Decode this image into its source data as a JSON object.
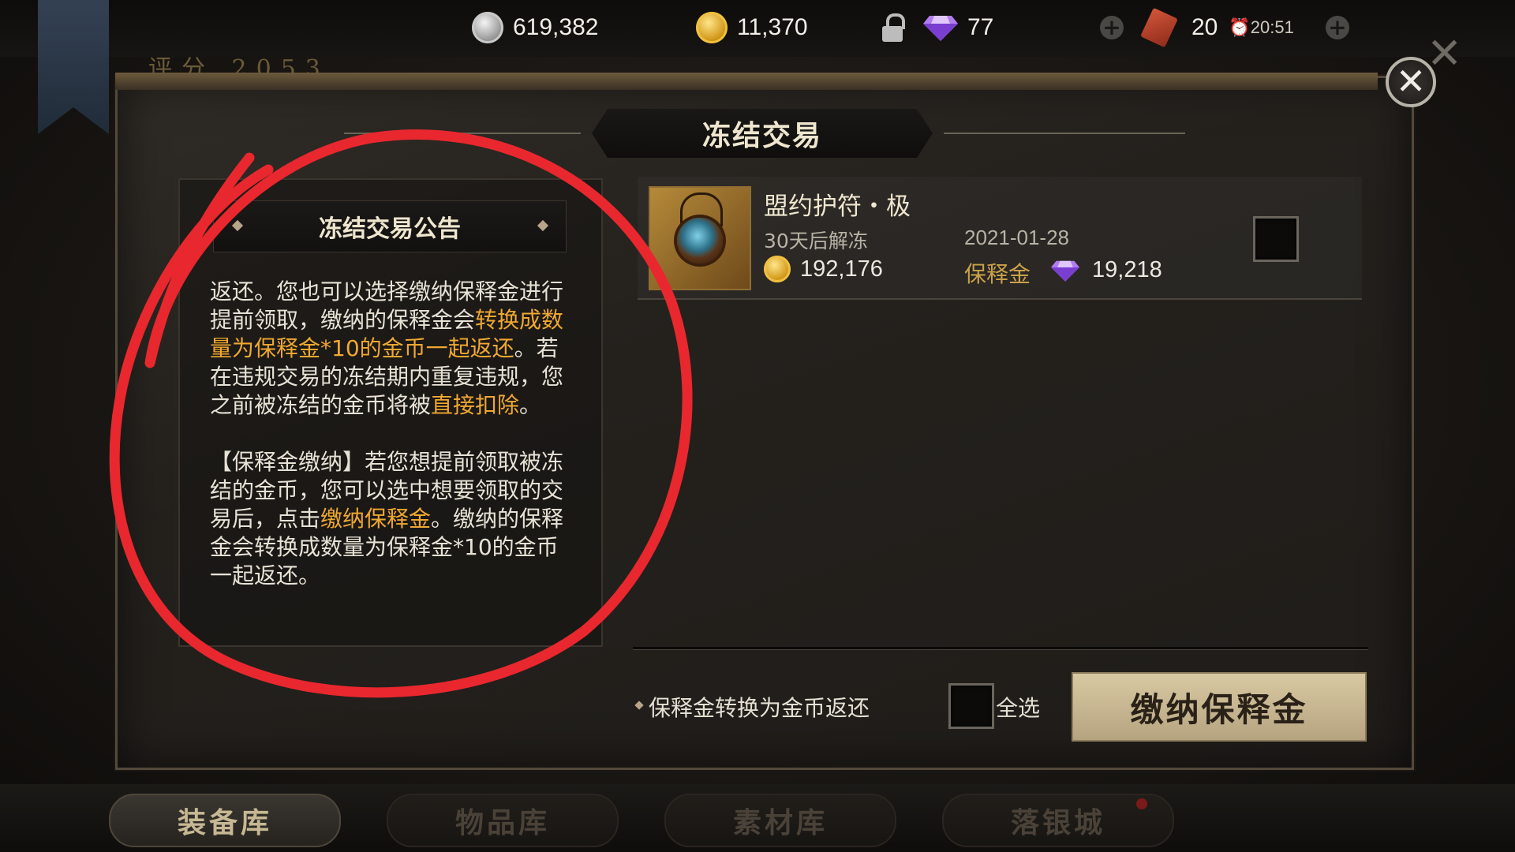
{
  "resources": {
    "silver": "619,382",
    "gold": "11,370",
    "diamonds": "77",
    "tickets": "20",
    "time": "20:51"
  },
  "score": {
    "label": "评分",
    "value": "2053"
  },
  "dialog": {
    "title": "冻结交易",
    "notice_title": "冻结交易公告",
    "notice_p1_a": "返还。您也可以选择缴纳保释金进行提前领取，缴纳的保释金会",
    "notice_p1_hl1": "转换成数量为保释金*10的金币一起返还",
    "notice_p1_b": "。若在违规交易的冻结期内重复违规，您之前被冻结的金币将被",
    "notice_p1_hl2": "直接扣除",
    "notice_p1_c": "。",
    "notice_p2_a": "【保释金缴纳】若您想提前领取被冻结的金币，您可以选中想要领取的交易后，点击",
    "notice_p2_hl": "缴纳保释金",
    "notice_p2_b": "。缴纳的保释金会转换成数量为保释金*10的金币一起返还。",
    "item": {
      "name": "盟约护符・极",
      "unfreeze": "30天后解冻",
      "date": "2021-01-28",
      "gold_amount": "192,176",
      "bail_label": "保释金",
      "bail_amount": "19,218"
    },
    "bottom_note": "保释金转换为金币返还",
    "select_all": "全选",
    "pay_button": "缴纳保释金"
  },
  "tabs": [
    "装备库",
    "物品库",
    "素材库",
    "落银城"
  ],
  "colors": {
    "highlight": "#f0a830",
    "annotation": "#e8282e"
  },
  "icons": [
    "silver-coin-icon",
    "gold-coin-icon",
    "lock-icon",
    "diamond-icon",
    "ticket-icon",
    "clock-icon",
    "plus-icon",
    "close-icon",
    "amulet-icon"
  ]
}
